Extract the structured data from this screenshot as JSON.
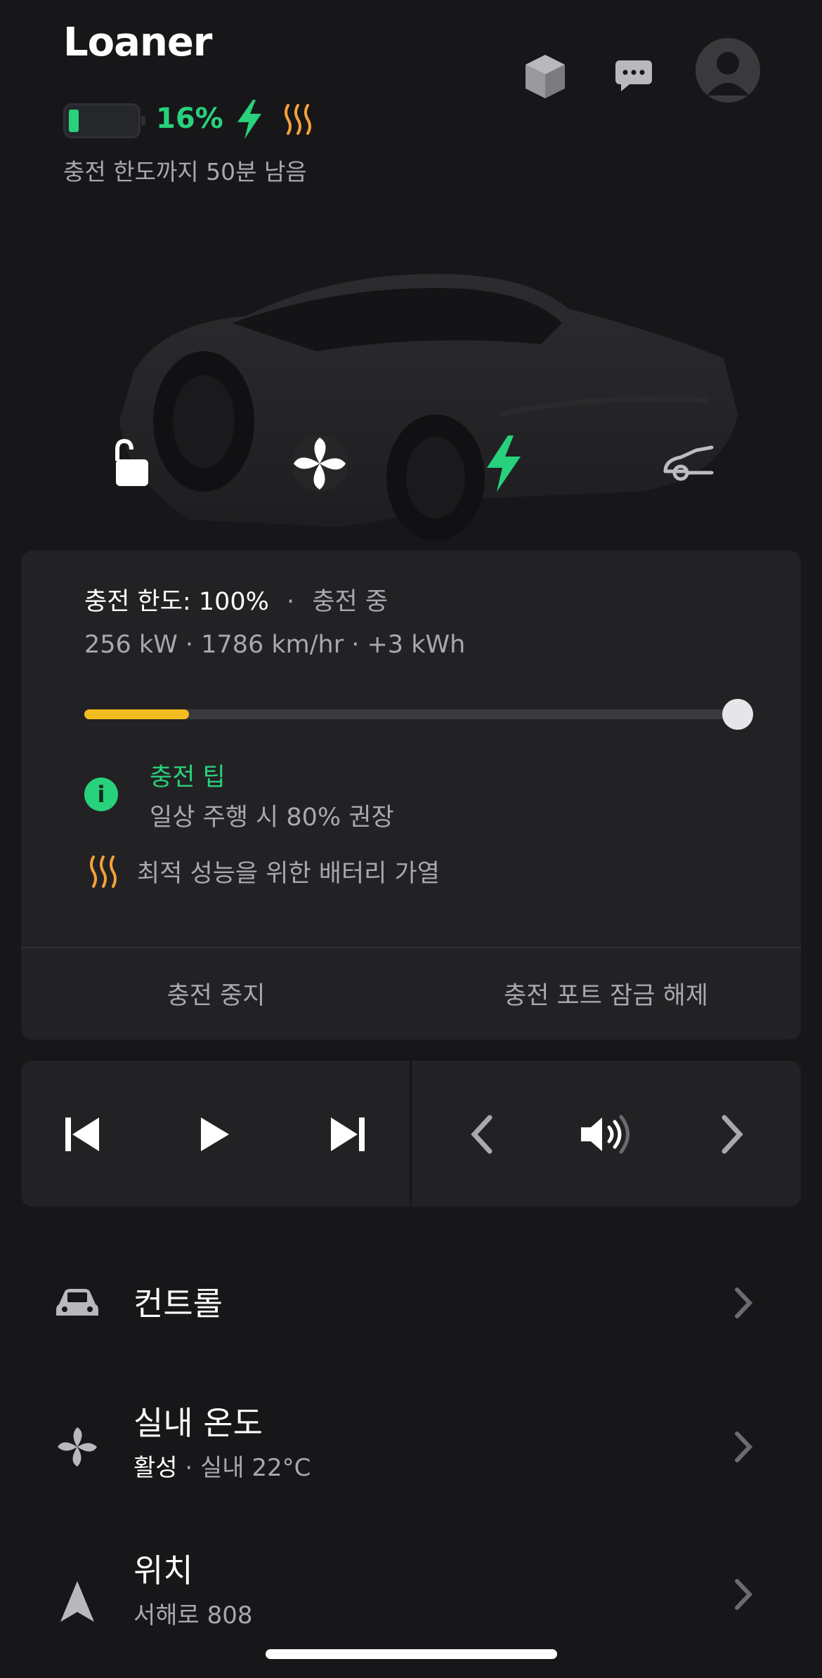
{
  "header": {
    "title": "Loaner",
    "battery_percent_label": "16%",
    "battery_level": 0.16,
    "charge_subtitle": "충전 한도까지 50분 남음",
    "icons": [
      "cube-icon",
      "chat-icon",
      "avatar-icon",
      "lightning-icon",
      "heat-icon"
    ]
  },
  "quick_actions": [
    {
      "name": "unlock",
      "icon": "unlock-icon"
    },
    {
      "name": "climate",
      "icon": "fan-icon"
    },
    {
      "name": "charge",
      "icon": "lightning-icon"
    },
    {
      "name": "trunk",
      "icon": "frunk-icon"
    }
  ],
  "charge_card": {
    "limit_label": "충전 한도: 100%",
    "separator": "·",
    "status": "충전 중",
    "stats": "256 kW  ·  1786 km/hr  ·  +3 kWh",
    "charge_fraction": 0.16,
    "limit_fraction": 1.0,
    "tip_title": "충전 팁",
    "tip_body": "일상 주행 시 80% 권장",
    "heat_text": "최적 성능을 위한 배터리 가열",
    "stop_button": "충전 중지",
    "unlock_port_button": "충전 포트 잠금 해제",
    "colors": {
      "accent_green": "#28d17c",
      "progress_yellow": "#f4bd1f"
    }
  },
  "media": {
    "buttons": [
      "previous-track-icon",
      "play-icon",
      "next-track-icon",
      "previous-source-icon",
      "volume-icon",
      "next-source-icon"
    ]
  },
  "list": [
    {
      "title": "컨트롤",
      "icon": "car-icon"
    },
    {
      "title": "실내 온도",
      "sub_active": "활성",
      "sub_rest": " · 실내 22°C",
      "icon": "fan-icon"
    },
    {
      "title": "위치",
      "sub": "서해로 808",
      "icon": "navigation-arrow-icon"
    }
  ]
}
